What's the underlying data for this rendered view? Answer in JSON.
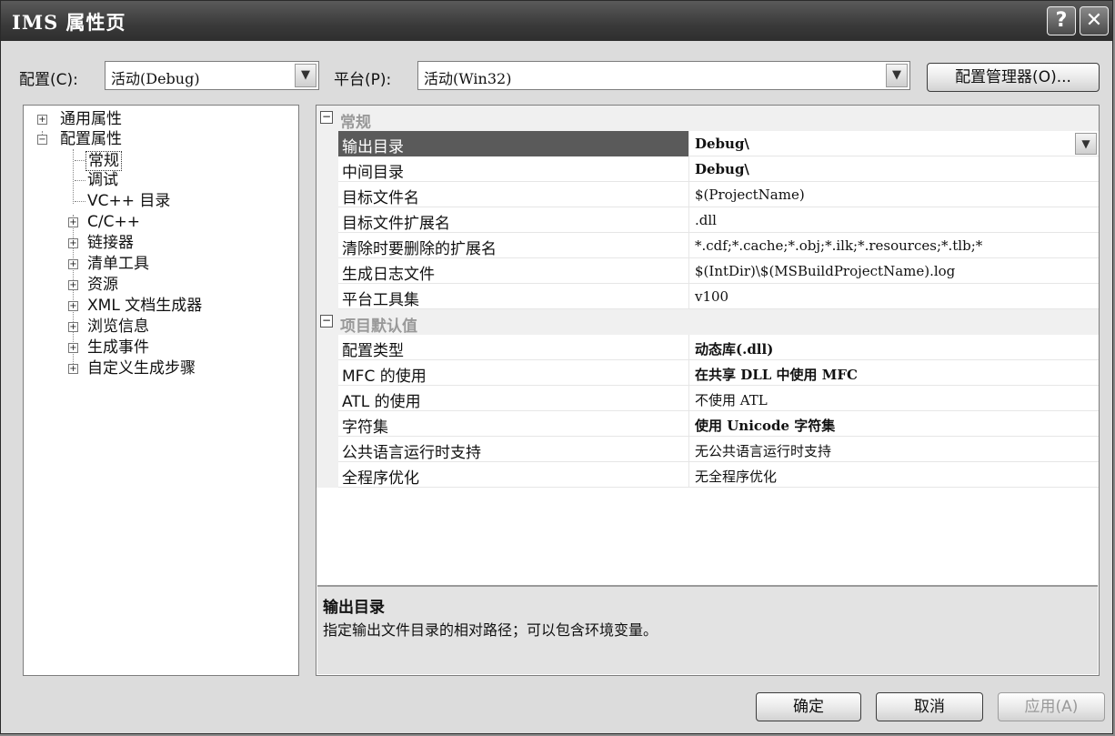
{
  "window": {
    "title": "IMS 属性页"
  },
  "titlebar": {
    "help": "?",
    "close": "✕"
  },
  "config": {
    "label": "配置(C):",
    "value": "活动(Debug)"
  },
  "platform": {
    "label": "平台(P):",
    "value": "活动(Win32)"
  },
  "manager_button": "配置管理器(O)...",
  "tree": {
    "common": "通用属性",
    "config": "配置属性",
    "children": [
      "常规",
      "调试",
      "VC++ 目录"
    ],
    "groups": [
      "C/C++",
      "链接器",
      "清单工具",
      "资源",
      "XML 文档生成器",
      "浏览信息",
      "生成事件",
      "自定义生成步骤"
    ]
  },
  "grid": {
    "cat1": "常规",
    "rows1": [
      {
        "name": "输出目录",
        "value": "Debug\\",
        "bold": true
      },
      {
        "name": "中间目录",
        "value": "Debug\\",
        "bold": true
      },
      {
        "name": "目标文件名",
        "value": "$(ProjectName)",
        "bold": false
      },
      {
        "name": "目标文件扩展名",
        "value": ".dll",
        "bold": false
      },
      {
        "name": "清除时要删除的扩展名",
        "value": "*.cdf;*.cache;*.obj;*.ilk;*.resources;*.tlb;*",
        "bold": false
      },
      {
        "name": "生成日志文件",
        "value": "$(IntDir)\\$(MSBuildProjectName).log",
        "bold": false
      },
      {
        "name": "平台工具集",
        "value": "v100",
        "bold": false
      }
    ],
    "cat2": "项目默认值",
    "rows2": [
      {
        "name": "配置类型",
        "value": "动态库(.dll)",
        "bold": true
      },
      {
        "name": "MFC 的使用",
        "value": "在共享 DLL 中使用 MFC",
        "bold": true
      },
      {
        "name": "ATL 的使用",
        "value": "不使用 ATL",
        "bold": false
      },
      {
        "name": "字符集",
        "value": "使用 Unicode 字符集",
        "bold": true
      },
      {
        "name": "公共语言运行时支持",
        "value": "无公共语言运行时支持",
        "bold": false
      },
      {
        "name": "全程序优化",
        "value": "无全程序优化",
        "bold": false
      }
    ]
  },
  "description": {
    "title": "输出目录",
    "text": "指定输出文件目录的相对路径；可以包含环境变量。"
  },
  "buttons": {
    "ok": "确定",
    "cancel": "取消",
    "apply": "应用(A)"
  }
}
